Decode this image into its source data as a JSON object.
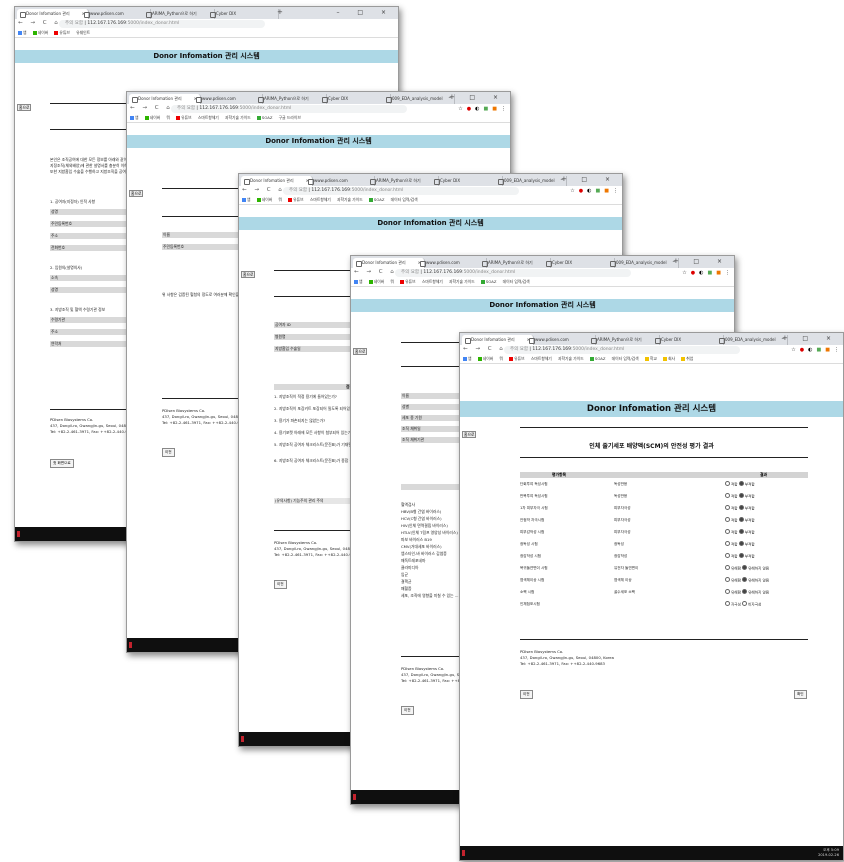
{
  "browser": {
    "tabs": [
      "Donor Infomation 관리",
      "www.pdisen.com",
      "ARIMA_Python으로 하기",
      "Cyber DIX",
      "009_EDA_analysis_model"
    ],
    "url_prefix": "주의 요함",
    "url_host": "112.167.176.169",
    "url_path": ":5000/index_donor.html",
    "window_controls": "– □ ×",
    "bookmarks": [
      "앱",
      "네이버",
      "뭐",
      "유튜브",
      "유쉐인트",
      "스마트항체기",
      "과학기술 가이드",
      "SOAZ",
      "구글 드라이브",
      "데이터 입력/검색",
      "학교",
      "회사",
      "취업"
    ]
  },
  "app": {
    "header_title": "Donor Infomation 관리 시스템",
    "home_label": "홈으로",
    "footer": {
      "company": "PDIsen Biosystems Co.",
      "address": "437, Dongil-ro, Gwangjin-gu, Seoul, 04800, Korea",
      "phone": "Tel: +82-2-461-3971, Fax: ++82-2-440-9683"
    },
    "prev_label": "이전",
    "next_label": "확인",
    "home_page_label": "첫 화면으로"
  },
  "win1": {
    "intro": [
      "본인은 조직공여에 대한 모든 정보를 아래와 같이 고지 받았으며",
      "지정조직(체외배양)에 관한 설명서를 충분히 이해하였습니다.",
      "또한 지방흡입 수술을 수행하고 지방조직을 공여하는 것에 동의합니다."
    ],
    "sec1": "1. 공여자(지정자) 인적 사항",
    "sec1_fields": [
      "성명",
      "주민등록번호",
      "주소",
      "전화번호"
    ],
    "sec2": "2. 입원의(설명의사)",
    "sec2_fields": [
      "소속",
      "성명"
    ],
    "sec3": "3. 지방조직 및 혈액 수령기관 정보",
    "sec3_fields": [
      "수령기관",
      "주소",
      "연락처"
    ]
  },
  "win2": {
    "fields": [
      "이름",
      "주민등록번호"
    ],
    "notice": "위 사항은 검증된 혈청의 정도로 여러분께 확인을..."
  },
  "win3": {
    "fields": [
      "공여자 ID",
      "병원명",
      "지방흡입 수술일"
    ],
    "section": "점검",
    "checks": [
      "1. 지방조직이 적정 용기에 들어있는가?",
      "2. 지방조직이 포장키트 포장되어 밀도록 되어있는가?",
      "3. 용기가 파손되지는 않았는가?",
      "4. 용기포켓 아래에 모든 사항이 첨부되어 있는가?",
      "5. 지방조직 공여자 체크리스트(문진표)가 기재된 기 모두 작성되어 있는가?",
      "6. 지방조직 공여자 체크리스트(문진표)가 종합 결과 상으로 적합한가?"
    ],
    "remark": "(유의사항) 기능주의 관리 주의"
  },
  "win4": {
    "fields": [
      "이름",
      "성별",
      "세포 종 기원",
      "조직 채취일",
      "조직 채취기관"
    ],
    "list": [
      "혈액검사",
      "HBV(B형 간염 바이러스)",
      "HCV(C형 간염 바이러스)",
      "HIV(인체 면역결핍 바이러스)",
      "HTLV(인체 T림프 영양성 바이러스)",
      "파보 바이러스 B19",
      "CMV(거대세포 바이러스)",
      "엡스타인-바 바이러스 감염증",
      "매독트레포네마",
      "클라미디아",
      "임균",
      "결핵균",
      "패혈증",
      "세포, 조직에 영향을 미칠 수 있는 ..."
    ]
  },
  "win5": {
    "title": "인체 줄기세포 배양액(SCM)의 안전성 평가 결과",
    "col_item": "평가항목",
    "col_result": "결과",
    "rows": [
      {
        "item": "단회투여 독성시험",
        "result": "독성반응",
        "a": "적합",
        "b": "부적합",
        "on": 1
      },
      {
        "item": "반복투여 독성시험",
        "result": "독성반응",
        "a": "적합",
        "b": "부적합",
        "on": 1
      },
      {
        "item": "1차 피부자극 시험",
        "result": "피부자극성",
        "a": "적합",
        "b": "부적합",
        "on": 1
      },
      {
        "item": "안점막 자극시험",
        "result": "피부자극성",
        "a": "적합",
        "b": "부적합",
        "on": 1
      },
      {
        "item": "피부감작성 시험",
        "result": "피부자극성",
        "a": "적합",
        "b": "부적합",
        "on": 1
      },
      {
        "item": "광독성 시험",
        "result": "광독성",
        "a": "적합",
        "b": "부적합",
        "on": 1
      },
      {
        "item": "광감작성 시험",
        "result": "광감작성",
        "a": "적합",
        "b": "부적합",
        "on": 1
      },
      {
        "item": "복귀돌연변이 시험",
        "result": "유전자 돌연변이",
        "a": "유해함",
        "b": "유해하지 않음",
        "on": 1
      },
      {
        "item": "염색체이상 시험",
        "result": "염색체 이상",
        "a": "유해함",
        "b": "유해하지 않음",
        "on": 1
      },
      {
        "item": "소핵 시험",
        "result": "골수세포 소핵",
        "a": "유해함",
        "b": "유해하지 않음",
        "on": 1
      },
      {
        "item": "인체첩포시험",
        "result": "",
        "a": "자극성",
        "b": "비자극성",
        "on": 0
      }
    ]
  },
  "taskbar": {
    "time": "오후 5:09",
    "date": "2019-02-26"
  }
}
